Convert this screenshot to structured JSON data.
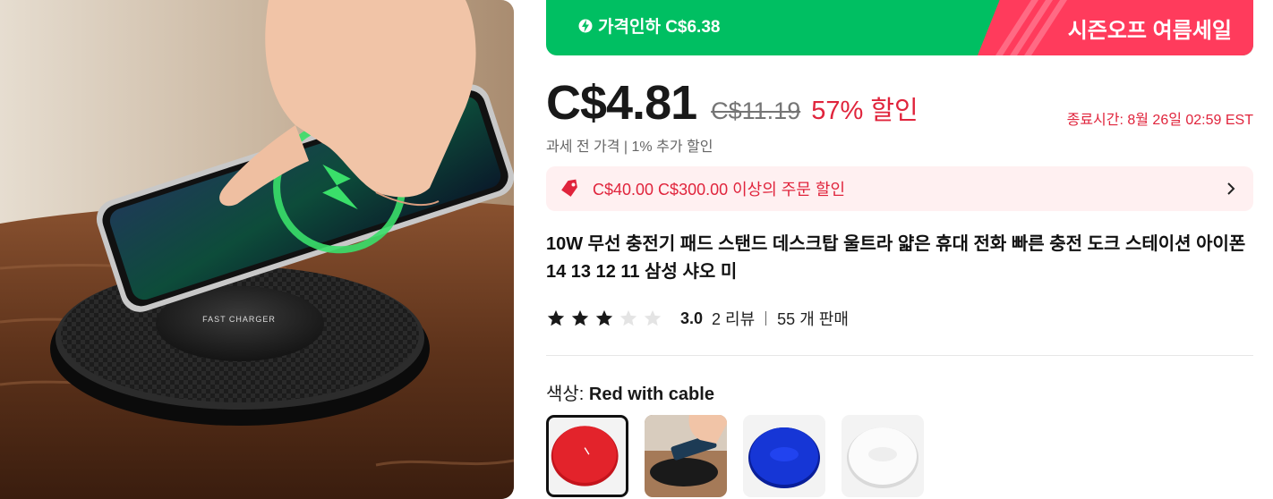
{
  "banner": {
    "price_drop": "가격인하 C$6.38",
    "sale_name": "시즌오프 여름세일",
    "icons": {
      "drop": "lightning-bolt-icon"
    },
    "colors": {
      "green": "#00bf62",
      "pink": "#ff3b5c"
    }
  },
  "pricing": {
    "current": "C$4.81",
    "original": "C$11.19",
    "discount": "57% 할인",
    "end_time": "종료시간: 8월 26일 02:59 EST",
    "tax_note": "과세 전 가격 | 1% 추가 할인",
    "accent_color": "#e0243c"
  },
  "coupon": {
    "text": "C$40.00 C$300.00 이상의 주문 할인",
    "icons": {
      "tag": "price-tag-icon",
      "more": "chevron-right-icon"
    }
  },
  "product": {
    "title": "10W 무선 충전기 패드 스탠드 데스크탑 울트라 얇은 휴대 전화 빠른 충전 도크 스테이션 아이폰 14 13 12 11 삼성 샤오 미",
    "rating_value": 3,
    "rating_max": 5,
    "rating": "3.0",
    "reviews": "2 리뷰",
    "sold": "55 개 판매",
    "image_text": "FAST CHARGER"
  },
  "color": {
    "label": "색상: ",
    "selected": "Red with cable",
    "options": [
      {
        "name": "red",
        "selected": true
      },
      {
        "name": "photo",
        "selected": false
      },
      {
        "name": "blue",
        "selected": false
      },
      {
        "name": "white",
        "selected": false
      }
    ]
  }
}
